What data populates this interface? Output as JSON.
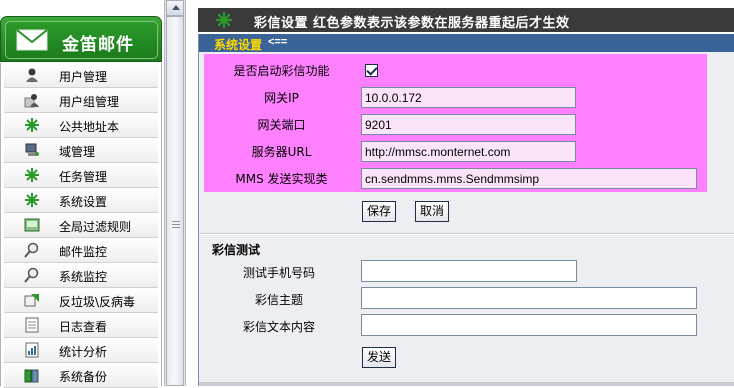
{
  "sidebar": {
    "logo_text": "金笛邮件",
    "items": [
      {
        "label": "用户管理",
        "icon": "user-icon"
      },
      {
        "label": "用户组管理",
        "icon": "user-group-icon"
      },
      {
        "label": "公共地址本",
        "icon": "address-book-icon"
      },
      {
        "label": "域管理",
        "icon": "domain-icon"
      },
      {
        "label": "任务管理",
        "icon": "task-icon"
      },
      {
        "label": "系统设置",
        "icon": "settings-icon"
      },
      {
        "label": "全局过滤规则",
        "icon": "filter-icon"
      },
      {
        "label": "邮件监控",
        "icon": "mail-monitor-icon"
      },
      {
        "label": "系统监控",
        "icon": "system-monitor-icon"
      },
      {
        "label": "反垃圾\\反病毒",
        "icon": "antispam-icon"
      },
      {
        "label": "日志查看",
        "icon": "log-icon"
      },
      {
        "label": "统计分析",
        "icon": "stats-icon"
      },
      {
        "label": "系统备份",
        "icon": "backup-icon"
      }
    ]
  },
  "header": {
    "title": "彩信设置   红色参数表示该参数在服务器重起后才生效"
  },
  "system_settings": {
    "section_label": "系统设置",
    "section_arrow": "<==",
    "enable_label": "是否启动彩信功能",
    "enable_checked": true,
    "gateway_ip_label": "网关IP",
    "gateway_ip_value": "10.0.0.172",
    "gateway_port_label": "网关端口",
    "gateway_port_value": "9201",
    "server_url_label": "服务器URL",
    "server_url_value": "http://mmsc.monternet.com",
    "mms_class_label": "MMS 发送实现类",
    "mms_class_value": "cn.sendmms.mms.Sendmmsimp",
    "save_label": "保存",
    "cancel_label": "取消"
  },
  "mms_test": {
    "title": "彩信测试",
    "phone_label": "测试手机号码",
    "subject_label": "彩信主题",
    "body_label": "彩信文本内容",
    "send_label": "发送"
  },
  "colors": {
    "highlight": "#ff80ff",
    "section_bar": "#3a6498",
    "section_label": "#ffd800",
    "logo_green": "#1e7a1e"
  }
}
